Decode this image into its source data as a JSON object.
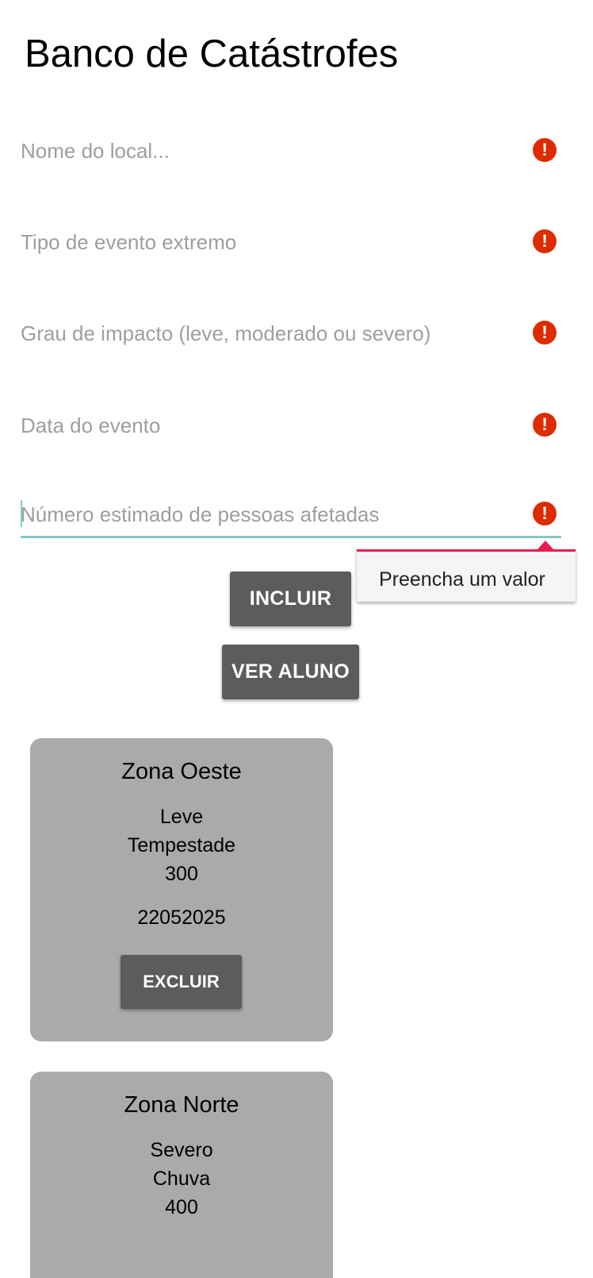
{
  "app": {
    "title": "Banco de Catástrofes"
  },
  "form": {
    "fields": [
      {
        "placeholder": "Nome do local...",
        "value": ""
      },
      {
        "placeholder": "Tipo de evento extremo",
        "value": ""
      },
      {
        "placeholder": "Grau de impacto (leve, moderado ou severo)",
        "value": ""
      },
      {
        "placeholder": "Data do evento",
        "value": ""
      },
      {
        "placeholder": "Número estimado de pessoas afetadas",
        "value": ""
      }
    ],
    "error_icon": "!",
    "validation_tooltip": "Preencha um valor"
  },
  "buttons": {
    "incluir": "INCLUIR",
    "ver": "VER ALUNO"
  },
  "records": [
    {
      "local": "Zona Oeste",
      "grau": "Leve",
      "tipo": "Tempestade",
      "pessoas": "300",
      "data": "22052025",
      "excluir": "EXCLUIR"
    },
    {
      "local": "Zona Norte",
      "grau": "Severo",
      "tipo": "Chuva",
      "pessoas": "400"
    }
  ],
  "colors": {
    "error": "#dd2c00",
    "active_underline": "#80cbc4",
    "tooltip_accent": "#e91e4e",
    "button": "#5c5c5c",
    "card": "#aaaaaa"
  }
}
